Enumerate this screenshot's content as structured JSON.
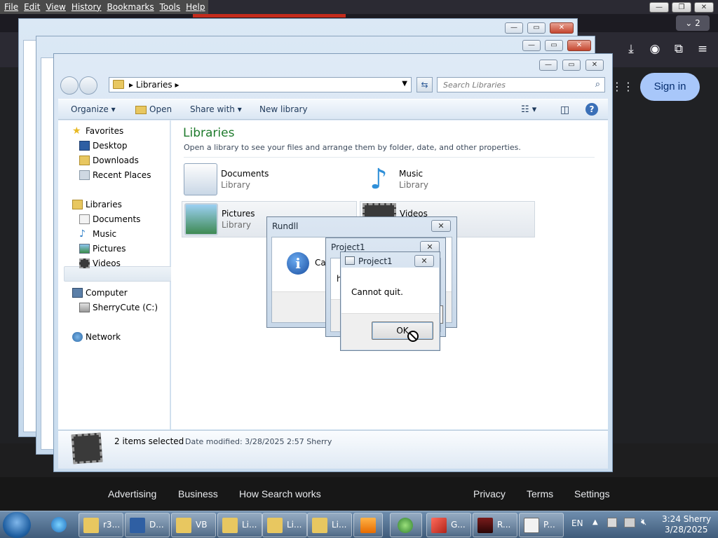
{
  "browser": {
    "menus": [
      "File",
      "Edit",
      "View",
      "History",
      "Bookmarks",
      "Tools",
      "Help"
    ],
    "tab_count": "⌄ 2",
    "sign_in": "Sign in",
    "footer_left": [
      "Advertising",
      "Business",
      "How Search works"
    ],
    "footer_right": [
      "Privacy",
      "Terms",
      "Settings"
    ]
  },
  "explorer": {
    "breadcrumb": "Libraries",
    "search_placeholder": "Search Libraries",
    "toolbar": {
      "organize": "Organize ▾",
      "open": "Open",
      "share_with": "Share with ▾",
      "new_library": "New library"
    },
    "nav": {
      "favorites": "Favorites",
      "desktop": "Desktop",
      "downloads": "Downloads",
      "recent_places": "Recent Places",
      "libraries": "Libraries",
      "documents": "Documents",
      "music": "Music",
      "pictures": "Pictures",
      "videos": "Videos",
      "computer": "Computer",
      "drive": "SherryCute (C:)",
      "network": "Network"
    },
    "main": {
      "title": "Libraries",
      "subtitle": "Open a library to see your files and arrange them by folder, date, and other properties.",
      "tiles": [
        {
          "name": "Documents",
          "type": "Library"
        },
        {
          "name": "Music",
          "type": "Library"
        },
        {
          "name": "Pictures",
          "type": "Library"
        },
        {
          "name": "Videos",
          "type": ""
        }
      ]
    },
    "details": {
      "count": "2 items selected",
      "meta": "Date modified: 3/28/2025 2:57 Sherry"
    }
  },
  "dialogs": {
    "rundll": {
      "title": "Rundll",
      "text": "Ca"
    },
    "project_back": {
      "title": "Project1",
      "text": "h"
    },
    "project_front": {
      "title": "Project1",
      "text": "Cannot quit.",
      "ok": "OK"
    }
  },
  "taskbar": {
    "buttons": [
      {
        "label": "r3..."
      },
      {
        "label": "D..."
      },
      {
        "label": "VB"
      },
      {
        "label": "Li..."
      },
      {
        "label": "Li..."
      },
      {
        "label": "Li..."
      },
      {
        "label": ""
      },
      {
        "label": ""
      },
      {
        "label": "G..."
      },
      {
        "label": "R..."
      },
      {
        "label": "P..."
      }
    ],
    "language": "EN",
    "time": "3:24 Sherry",
    "date": "3/28/2025"
  },
  "colors": {
    "library_title": "#1e7a2c",
    "signin_bg": "#a8c7fa",
    "page_bg": "#202124"
  },
  "icons": [
    "search-icon",
    "help-icon",
    "info-icon",
    "not-allowed-cursor-icon",
    "download-icon",
    "account-icon",
    "extensions-icon",
    "menu-icon",
    "apps-grid-icon"
  ]
}
